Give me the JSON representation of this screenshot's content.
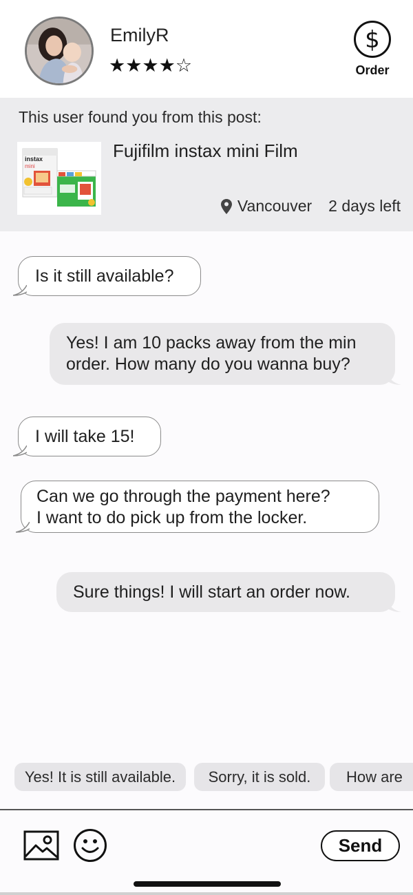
{
  "header": {
    "username": "EmilyR",
    "rating": 4,
    "rating_max": 5,
    "stars_text": "★★★★☆",
    "order_label": "Order",
    "order_icon": "dollar-circle-icon"
  },
  "post": {
    "intro": "This user found you from this post:",
    "title": "Fujifilm instax mini Film",
    "location": "Vancouver",
    "time_left": "2 days left",
    "thumb_brand_text": "instax",
    "thumb_product_text": "mini"
  },
  "messages": [
    {
      "from": "them",
      "text": "Is it still available?"
    },
    {
      "from": "me",
      "lines": [
        "Yes! I am 10 packs away from the min",
        "order. How many do you wanna buy?"
      ]
    },
    {
      "from": "them",
      "text": "I will take 15!"
    },
    {
      "from": "them",
      "lines": [
        "Can we go through the payment here?",
        "I want to do pick up from the locker."
      ]
    },
    {
      "from": "me",
      "text": "Sure things! I will start an order now."
    }
  ],
  "quick_replies": [
    "Yes! It is still available.",
    "Sorry, it is sold.",
    "How are"
  ],
  "input_bar": {
    "send_label": "Send",
    "image_icon": "image-icon",
    "emoji_icon": "emoji-icon"
  },
  "colors": {
    "incoming_bubble": "#ffffff",
    "outgoing_bubble": "#e9e8ea",
    "post_panel": "#ececee",
    "chip": "#e6e5e8",
    "text": "#1a1a1a"
  }
}
